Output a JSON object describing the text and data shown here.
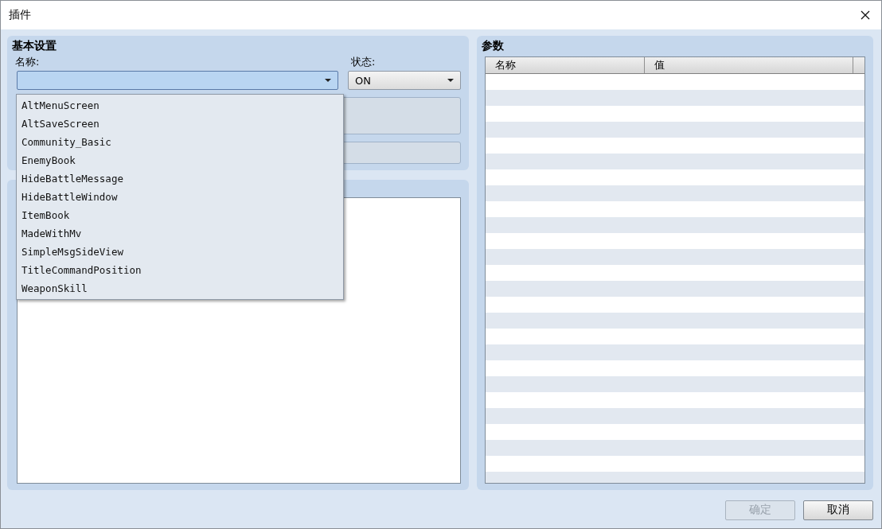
{
  "window": {
    "title": "插件"
  },
  "basic_settings": {
    "title": "基本设置",
    "name_label": "名称:",
    "status_label": "状态:",
    "status_select": {
      "value": "ON"
    },
    "name_dropdown": {
      "expanded": true,
      "options": [
        {
          "label": "AltMenuScreen"
        },
        {
          "label": "AltSaveScreen"
        },
        {
          "label": "Community_Basic"
        },
        {
          "label": "EnemyBook"
        },
        {
          "label": "HideBattleMessage"
        },
        {
          "label": "HideBattleWindow"
        },
        {
          "label": "ItemBook"
        },
        {
          "label": "MadeWithMv"
        },
        {
          "label": "SimpleMsgSideView"
        },
        {
          "label": "TitleCommandPosition"
        },
        {
          "label": "WeaponSkill"
        }
      ]
    }
  },
  "parameters": {
    "title": "参数",
    "columns": [
      "名称",
      "值"
    ]
  },
  "buttons": [
    {
      "label": "确定",
      "disabled": true
    },
    {
      "label": "取消",
      "disabled": false
    }
  ]
}
